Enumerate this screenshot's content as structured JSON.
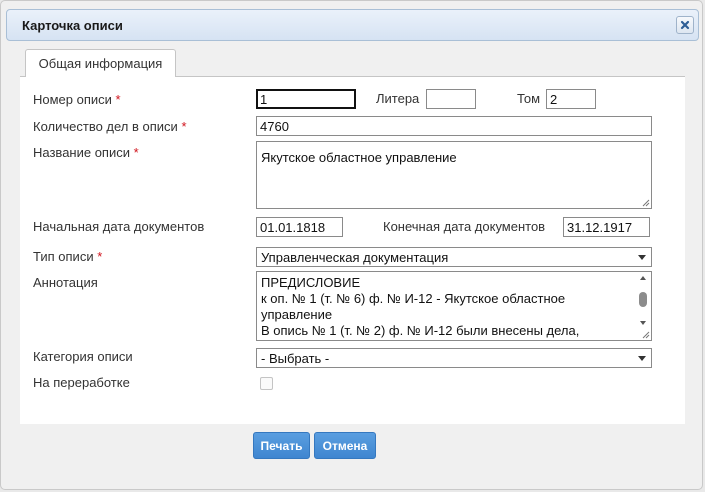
{
  "dialog": {
    "title": "Карточка описи",
    "close_icon": "close-icon"
  },
  "tabs": [
    {
      "label": "Общая информация",
      "active": true
    }
  ],
  "form": {
    "inventory_number": {
      "label": "Номер описи",
      "required_mark": "*",
      "value": "1"
    },
    "litera": {
      "label": "Литера",
      "value": ""
    },
    "volume": {
      "label": "Том",
      "value": "2"
    },
    "cases_count": {
      "label": "Количество дел в описи",
      "required_mark": "*",
      "value": "4760"
    },
    "inventory_name": {
      "label": "Название описи",
      "required_mark": "*",
      "value": "Якутское областное управление"
    },
    "start_date": {
      "label": "Начальная дата документов",
      "value": "01.01.1818"
    },
    "end_date": {
      "label": "Конечная дата документов",
      "value": "31.12.1917"
    },
    "inventory_type": {
      "label": "Тип описи",
      "required_mark": "*",
      "selected": "Управленческая документация"
    },
    "annotation": {
      "label": "Аннотация",
      "lines": [
        "ПРЕДИСЛОВИЕ",
        "к оп. № 1 (т. № 6) ф. № И-12 - Якутское областное",
        "управление",
        "В опись № 1 (т. № 2) ф. № И-12 были внесены дела,"
      ]
    },
    "category": {
      "label": "Категория описи",
      "selected": "- Выбрать -"
    },
    "in_rework": {
      "label": "На переработке",
      "checked": false
    }
  },
  "buttons": {
    "print": "Печать",
    "cancel": "Отмена"
  },
  "colors": {
    "accent": "#4a90d9",
    "required": "#d0121b"
  }
}
